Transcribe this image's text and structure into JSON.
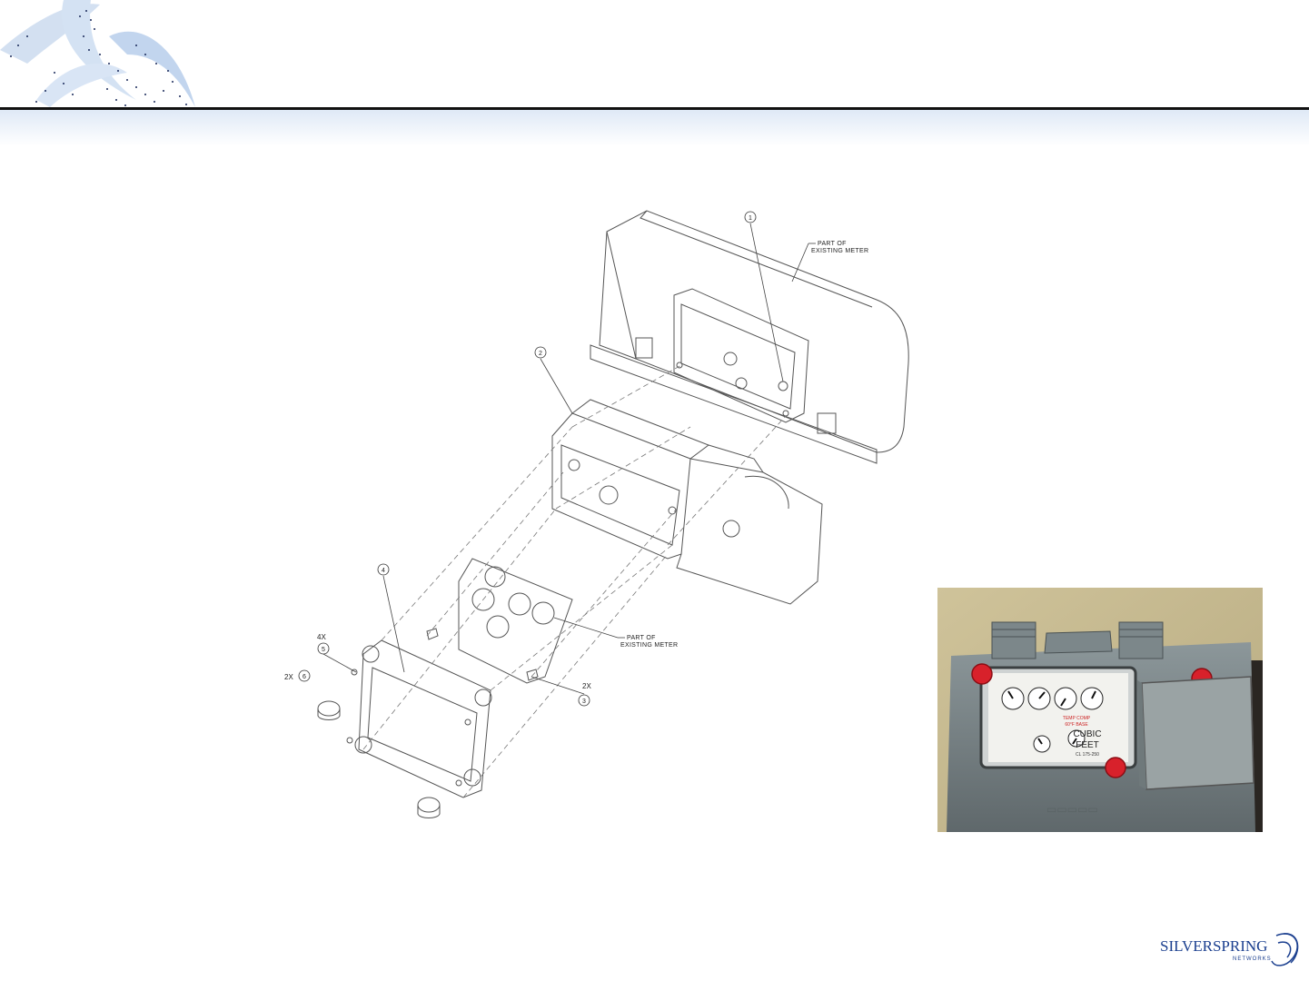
{
  "diagram": {
    "callouts": {
      "existing_meter_top_line1": "PART OF",
      "existing_meter_top_line2": "EXISTING METER",
      "existing_meter_bottom_line1": "PART OF",
      "existing_meter_bottom_line2": "EXISTING METER"
    },
    "bubbles": {
      "b1": "1",
      "b2": "2",
      "b3": "3",
      "b4": "4",
      "b5": "5",
      "b6": "6"
    },
    "quantities": {
      "q4x": "4X",
      "q2x_left": "2X",
      "q2x_right": "2X"
    }
  },
  "photo": {
    "dial_label_top": "TEMP COMP",
    "dial_label_base": "60°F BASE",
    "unit_line1": "CUBIC",
    "unit_line2": "FEET",
    "class_label": "CL 175-250"
  },
  "logo": {
    "word": "SILVERSPRING",
    "sub": "NETWORKS"
  },
  "colors": {
    "header_swoosh": "#b9cde8",
    "header_rule": "#111111",
    "meter_gray": "#7f8a8e",
    "seal_red": "#d8212b",
    "logo_blue": "#1b3f8f"
  }
}
